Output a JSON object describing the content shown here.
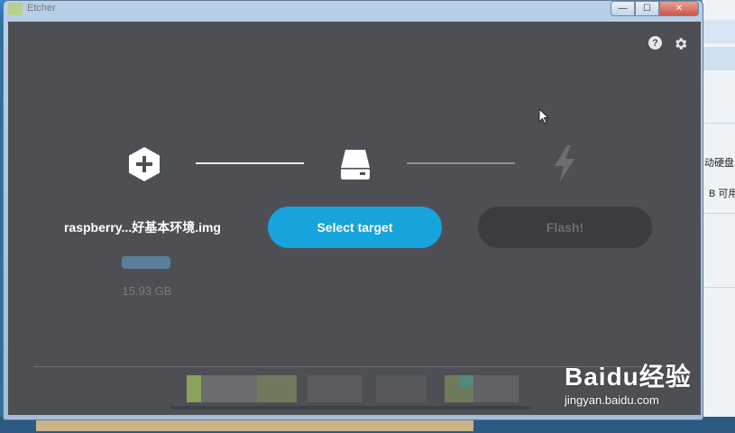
{
  "window": {
    "title": "Etcher"
  },
  "titlebar": {
    "minimize": "—",
    "maximize": "☐",
    "close": "✕"
  },
  "header": {
    "help_icon": "?",
    "settings_icon": "gear"
  },
  "steps": {
    "image": {
      "name": "raspberry...好基本环境.img",
      "size": "15.93 GB"
    },
    "target": {
      "button_label": "Select target"
    },
    "flash": {
      "button_label": "Flash!"
    }
  },
  "colors": {
    "accent": "#17a4dc",
    "background": "#4d4f55",
    "disabled_button": "#3a3c42"
  },
  "background_window": {
    "text_1": "动硬盘",
    "text_2": "B 可用"
  },
  "watermark": {
    "brand": "Baidu经验",
    "url": "jingyan.baidu.com"
  }
}
